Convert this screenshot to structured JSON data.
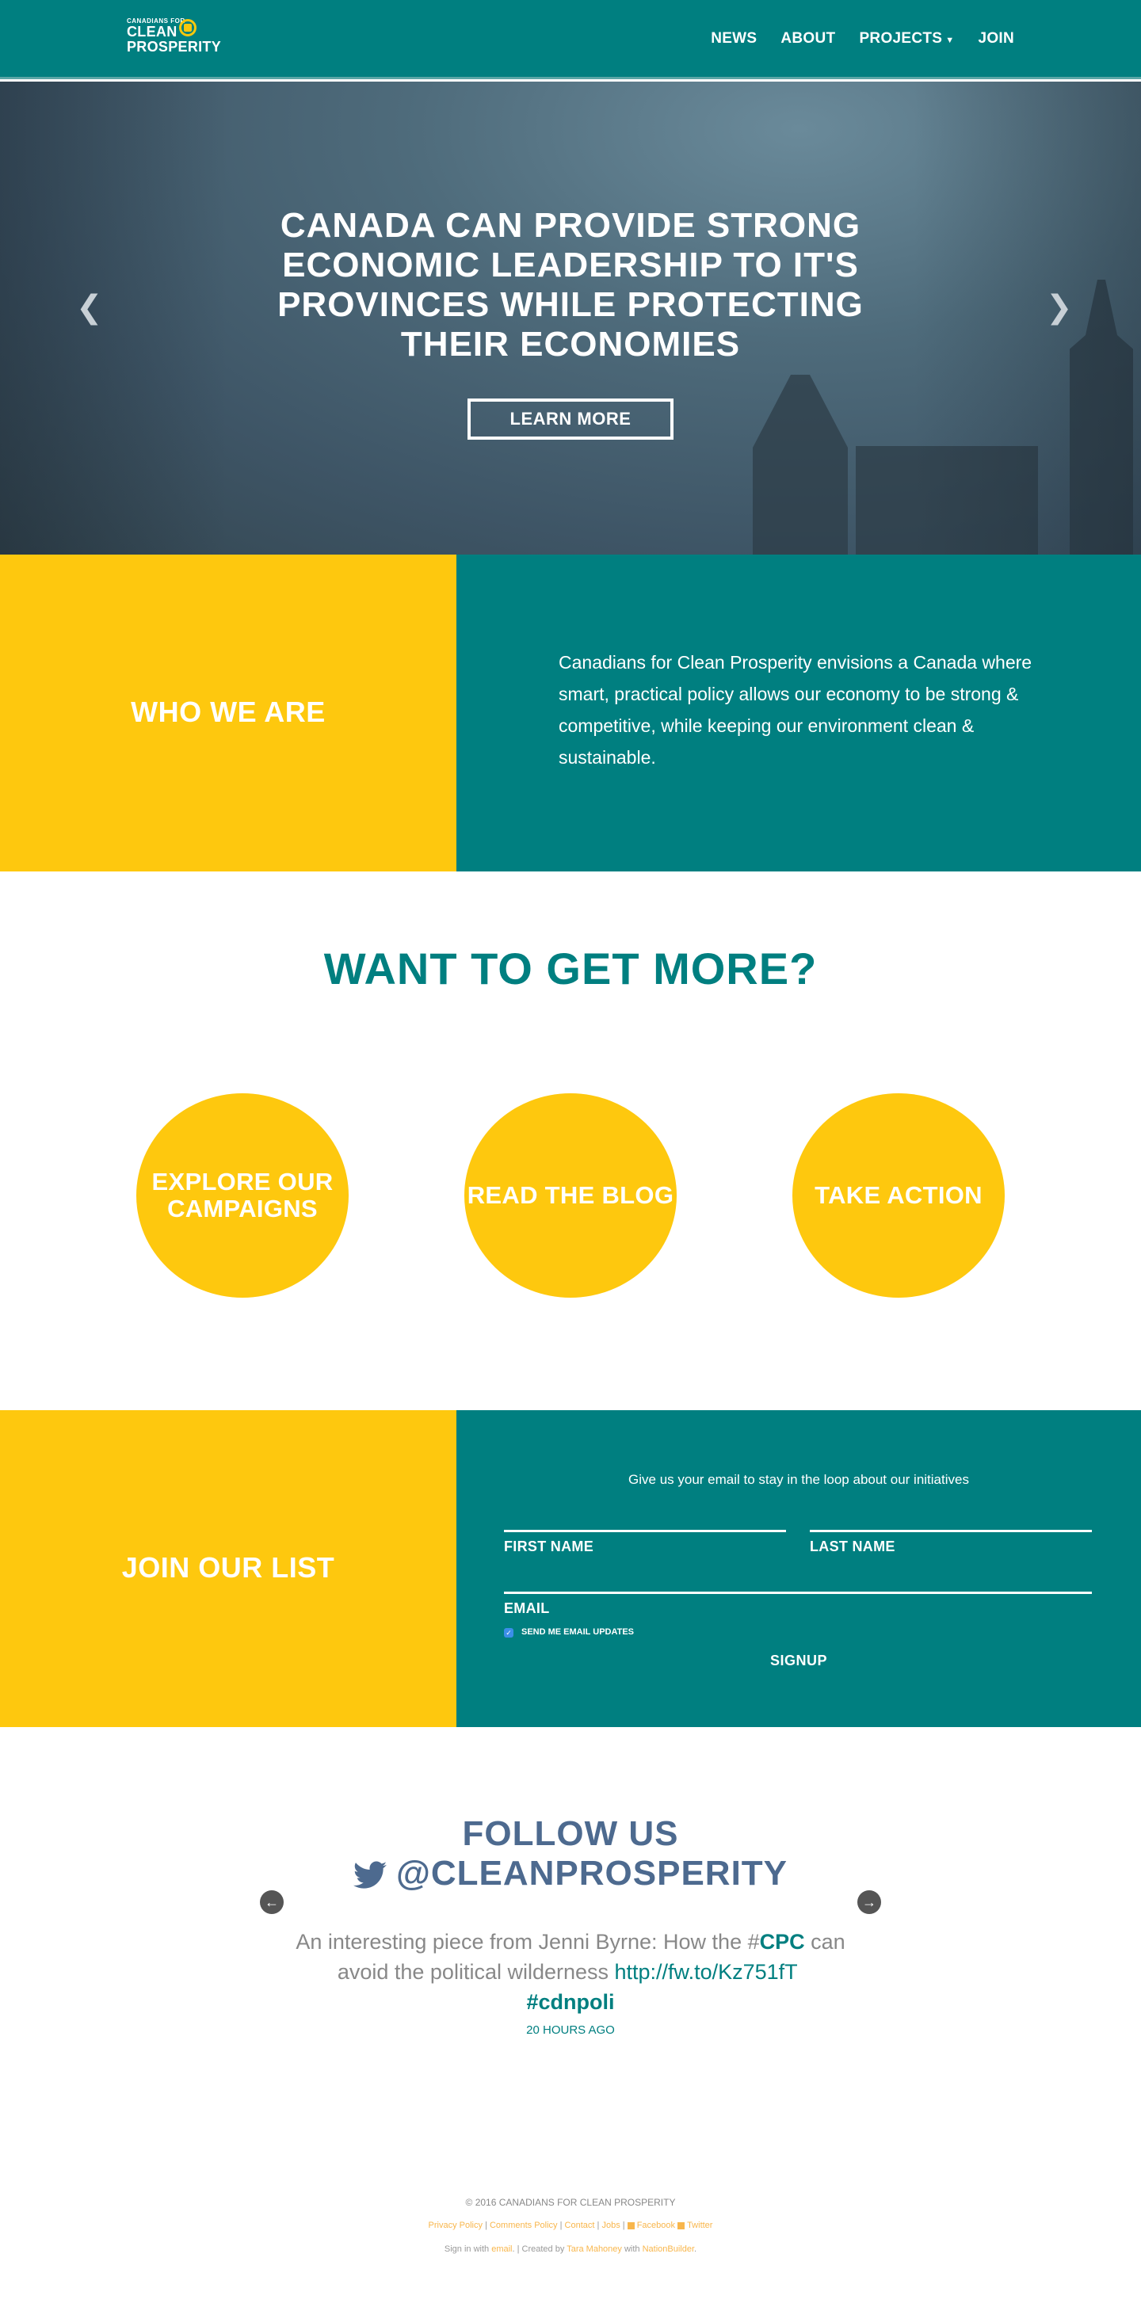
{
  "nav": {
    "logo_small": "CANADIANS FOR",
    "logo_line1": "CLEAN",
    "logo_line2": "PROSPERITY",
    "items": [
      {
        "label": "NEWS"
      },
      {
        "label": "ABOUT"
      },
      {
        "label": "PROJECTS"
      },
      {
        "label": "JOIN"
      }
    ]
  },
  "hero": {
    "title_lines": [
      "CANADA CAN PROVIDE STRONG",
      "ECONOMIC LEADERSHIP TO IT'S",
      "PROVINCES WHILE PROTECTING",
      "THEIR ECONOMIES"
    ],
    "button": "LEARN MORE",
    "prev_icon": "chevron-left-icon",
    "next_icon": "chevron-right-icon"
  },
  "who": {
    "heading": "WHO WE ARE",
    "text": "Canadians for Clean Prosperity envisions a Canada where smart, practical policy allows our economy to be strong & competitive, while keeping our environment clean & sustainable."
  },
  "more": {
    "heading": "WANT TO GET MORE?",
    "circles": [
      "EXPLORE OUR CAMPAIGNS",
      "READ THE BLOG",
      "TAKE ACTION"
    ]
  },
  "join": {
    "heading": "JOIN OUR LIST",
    "intro": "Give us your email to stay in the loop about our initiatives",
    "first_name": "FIRST NAME",
    "last_name": "LAST NAME",
    "email": "EMAIL",
    "checkbox_label": "SEND ME EMAIL UPDATES",
    "signup": "SIGNUP"
  },
  "follow": {
    "line1": "FOLLOW US",
    "line2": "@CLEANPROSPERITY",
    "tweet_pre": "An interesting piece from Jenni Byrne: How the #",
    "tweet_tag1": "CPC",
    "tweet_mid": " can avoid the political wilderness ",
    "tweet_link": "http://fw.to/Kz751fT",
    "tweet_tag2": "#cdnpoli",
    "ago": "20 HOURS AGO"
  },
  "footer": {
    "copyright": "© 2016 CANADIANS FOR CLEAN PROSPERITY",
    "links": [
      "Privacy Policy",
      "Comments Policy",
      "Contact",
      "Jobs",
      "Facebook",
      "Twitter"
    ],
    "signin_pre": "Sign in with",
    "signin_link": "email",
    "created_by": "Created by",
    "creator": "Tara Mahoney",
    "with": "with",
    "platform": "NationBuilder"
  },
  "colors": {
    "teal": "#007f80",
    "yellow": "#fec80e",
    "navy": "#4d6a8f",
    "link_orange": "#f8b64c"
  }
}
